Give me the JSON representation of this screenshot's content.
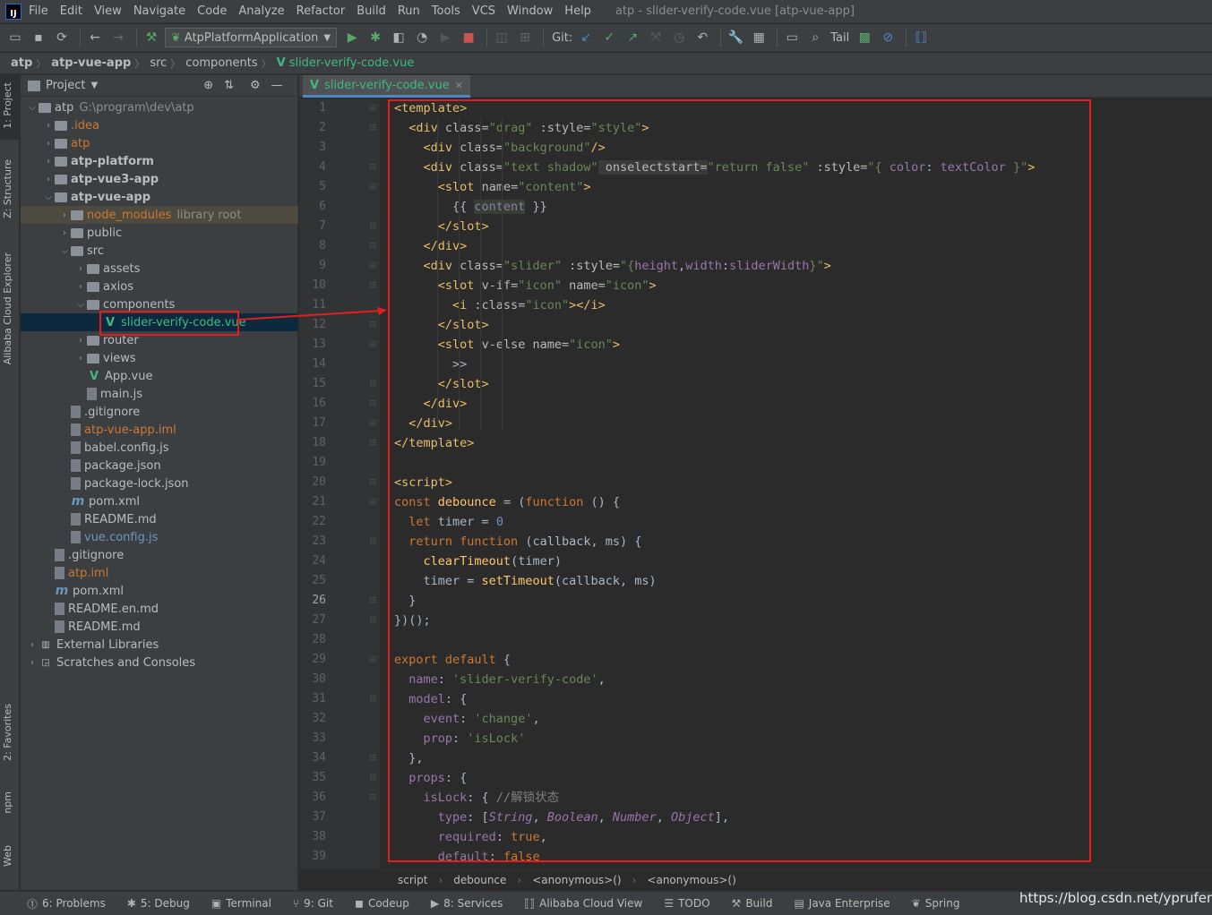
{
  "menu": {
    "logo": "IJ",
    "items": [
      "File",
      "Edit",
      "View",
      "Navigate",
      "Code",
      "Analyze",
      "Refactor",
      "Build",
      "Run",
      "Tools",
      "VCS",
      "Window",
      "Help"
    ],
    "window_title": "atp - slider-verify-code.vue [atp-vue-app]"
  },
  "toolbar": {
    "run_config": "AtpPlatformApplication",
    "git_label": "Git:",
    "tail_label": "Tail"
  },
  "breadcrumb": [
    "atp",
    "atp-vue-app",
    "src",
    "components",
    "slider-verify-code.vue"
  ],
  "left_tabs": {
    "project": "1: Project",
    "structure": "Z: Structure",
    "alibaba": "Alibaba Cloud Explorer",
    "favorites": "2: Favorites",
    "npm": "npm",
    "web": "Web"
  },
  "project_panel": {
    "title": "Project",
    "tree": [
      {
        "label": "atp",
        "hint": "G:\\program\\dev\\atp",
        "depth": 0,
        "type": "folder",
        "open": true
      },
      {
        "label": ".idea",
        "depth": 1,
        "type": "folder",
        "style": "orange"
      },
      {
        "label": "atp",
        "depth": 1,
        "type": "folder",
        "style": "orange"
      },
      {
        "label": "atp-platform",
        "depth": 1,
        "type": "folder",
        "bold": true
      },
      {
        "label": "atp-vue3-app",
        "depth": 1,
        "type": "folder",
        "bold": true
      },
      {
        "label": "atp-vue-app",
        "depth": 1,
        "type": "folder",
        "bold": true,
        "open": true
      },
      {
        "label": "node_modules",
        "hint": "library root",
        "depth": 2,
        "type": "folder",
        "style": "orange",
        "highlight": true
      },
      {
        "label": "public",
        "depth": 2,
        "type": "folder"
      },
      {
        "label": "src",
        "depth": 2,
        "type": "folder",
        "open": true
      },
      {
        "label": "assets",
        "depth": 3,
        "type": "folder"
      },
      {
        "label": "axios",
        "depth": 3,
        "type": "folder"
      },
      {
        "label": "components",
        "depth": 3,
        "type": "folder",
        "open": true
      },
      {
        "label": "slider-verify-code.vue",
        "depth": 4,
        "type": "vue",
        "selected": true
      },
      {
        "label": "router",
        "depth": 3,
        "type": "folder"
      },
      {
        "label": "views",
        "depth": 3,
        "type": "folder"
      },
      {
        "label": "App.vue",
        "depth": 3,
        "type": "vue",
        "leaf": true
      },
      {
        "label": "main.js",
        "depth": 3,
        "type": "file",
        "leaf": true
      },
      {
        "label": ".gitignore",
        "depth": 2,
        "type": "file",
        "leaf": true
      },
      {
        "label": "atp-vue-app.iml",
        "depth": 2,
        "type": "file",
        "style": "orange",
        "leaf": true
      },
      {
        "label": "babel.config.js",
        "depth": 2,
        "type": "file",
        "leaf": true
      },
      {
        "label": "package.json",
        "depth": 2,
        "type": "file",
        "leaf": true
      },
      {
        "label": "package-lock.json",
        "depth": 2,
        "type": "file",
        "leaf": true
      },
      {
        "label": "pom.xml",
        "depth": 2,
        "type": "m",
        "leaf": true
      },
      {
        "label": "README.md",
        "depth": 2,
        "type": "file",
        "leaf": true
      },
      {
        "label": "vue.config.js",
        "depth": 2,
        "type": "file",
        "style": "blue",
        "leaf": true
      },
      {
        "label": ".gitignore",
        "depth": 1,
        "type": "file",
        "leaf": true
      },
      {
        "label": "atp.iml",
        "depth": 1,
        "type": "file",
        "style": "orange",
        "leaf": true
      },
      {
        "label": "pom.xml",
        "depth": 1,
        "type": "m",
        "leaf": true
      },
      {
        "label": "README.en.md",
        "depth": 1,
        "type": "file",
        "leaf": true
      },
      {
        "label": "README.md",
        "depth": 1,
        "type": "file",
        "leaf": true
      },
      {
        "label": "External Libraries",
        "depth": 0,
        "type": "lib"
      },
      {
        "label": "Scratches and Consoles",
        "depth": 0,
        "type": "scratch"
      }
    ]
  },
  "editor": {
    "tab": "slider-verify-code.vue",
    "current_line": 26,
    "lines": [
      [
        [
          "tag",
          "<template>"
        ]
      ],
      [
        [
          "plain",
          "  "
        ],
        [
          "tag",
          "<div "
        ],
        [
          "attr",
          "class="
        ],
        [
          "str",
          "\"drag\""
        ],
        [
          "attr",
          " :style="
        ],
        [
          "str",
          "\"style\""
        ],
        [
          "tag",
          ">"
        ]
      ],
      [
        [
          "plain",
          "    "
        ],
        [
          "tag",
          "<div "
        ],
        [
          "attr",
          "class="
        ],
        [
          "str",
          "\"background\""
        ],
        [
          "tag",
          "/>"
        ]
      ],
      [
        [
          "plain",
          "    "
        ],
        [
          "tag",
          "<div "
        ],
        [
          "attr",
          "class="
        ],
        [
          "str",
          "\"text shadow\""
        ],
        [
          "attr",
          " onselectstart="
        ],
        [
          "str",
          "\"return false\""
        ],
        [
          "attr",
          " :style="
        ],
        [
          "str",
          "\"{ "
        ],
        [
          "prop",
          "color"
        ],
        [
          "plain",
          ": "
        ],
        [
          "prop",
          "textColor"
        ],
        [
          "str",
          " }\""
        ],
        [
          "tag",
          ">"
        ]
      ],
      [
        [
          "plain",
          "      "
        ],
        [
          "tag",
          "<slot "
        ],
        [
          "attr",
          "name="
        ],
        [
          "str",
          "\"content\""
        ],
        [
          "tag",
          ">"
        ]
      ],
      [
        [
          "plain",
          "        {{ "
        ],
        [
          "prop",
          "content"
        ],
        [
          "plain",
          " }}"
        ]
      ],
      [
        [
          "plain",
          "      "
        ],
        [
          "tag",
          "</slot>"
        ]
      ],
      [
        [
          "plain",
          "    "
        ],
        [
          "tag",
          "</div>"
        ]
      ],
      [
        [
          "plain",
          "    "
        ],
        [
          "tag",
          "<div "
        ],
        [
          "attr",
          "class="
        ],
        [
          "str",
          "\"slider\""
        ],
        [
          "attr",
          " :style="
        ],
        [
          "str",
          "\"{"
        ],
        [
          "prop",
          "height"
        ],
        [
          "plain",
          ","
        ],
        [
          "prop",
          "width"
        ],
        [
          "plain",
          ":"
        ],
        [
          "prop",
          "sliderWidth"
        ],
        [
          "str",
          "}\""
        ],
        [
          "tag",
          ">"
        ]
      ],
      [
        [
          "plain",
          "      "
        ],
        [
          "tag",
          "<slot "
        ],
        [
          "attr",
          "v-if="
        ],
        [
          "str",
          "\"icon\""
        ],
        [
          "attr",
          " name="
        ],
        [
          "str",
          "\"icon\""
        ],
        [
          "tag",
          ">"
        ]
      ],
      [
        [
          "plain",
          "        "
        ],
        [
          "tag",
          "<i "
        ],
        [
          "attr",
          ":class="
        ],
        [
          "str",
          "\"icon\""
        ],
        [
          "tag",
          "></i>"
        ]
      ],
      [
        [
          "plain",
          "      "
        ],
        [
          "tag",
          "</slot>"
        ]
      ],
      [
        [
          "plain",
          "      "
        ],
        [
          "tag",
          "<slot "
        ],
        [
          "attr",
          "v-else name="
        ],
        [
          "str",
          "\"icon\""
        ],
        [
          "tag",
          ">"
        ]
      ],
      [
        [
          "plain",
          "        >>"
        ]
      ],
      [
        [
          "plain",
          "      "
        ],
        [
          "tag",
          "</slot>"
        ]
      ],
      [
        [
          "plain",
          "    "
        ],
        [
          "tag",
          "</div>"
        ]
      ],
      [
        [
          "plain",
          "  "
        ],
        [
          "tag",
          "</div>"
        ]
      ],
      [
        [
          "tag",
          "</template>"
        ]
      ],
      [
        [
          "plain",
          ""
        ]
      ],
      [
        [
          "tag",
          "<script>"
        ]
      ],
      [
        [
          "kw",
          "const "
        ],
        [
          "fn",
          "debounce"
        ],
        [
          "plain",
          " = ("
        ],
        [
          "kw",
          "function"
        ],
        [
          "plain",
          " () {"
        ]
      ],
      [
        [
          "plain",
          "  "
        ],
        [
          "kw",
          "let "
        ],
        [
          "plain",
          "timer = "
        ],
        [
          "num",
          "0"
        ]
      ],
      [
        [
          "plain",
          "  "
        ],
        [
          "kw",
          "return function "
        ],
        [
          "plain",
          "(callback, ms) {"
        ]
      ],
      [
        [
          "plain",
          "    "
        ],
        [
          "fn",
          "clearTimeout"
        ],
        [
          "plain",
          "(timer)"
        ]
      ],
      [
        [
          "plain",
          "    timer = "
        ],
        [
          "fn",
          "setTimeout"
        ],
        [
          "plain",
          "(callback, ms)"
        ]
      ],
      [
        [
          "plain",
          "  }"
        ]
      ],
      [
        [
          "plain",
          "})();"
        ]
      ],
      [
        [
          "plain",
          ""
        ]
      ],
      [
        [
          "kw",
          "export default "
        ],
        [
          "plain",
          "{"
        ]
      ],
      [
        [
          "plain",
          "  "
        ],
        [
          "prop",
          "name"
        ],
        [
          "plain",
          ": "
        ],
        [
          "str",
          "'slider-verify-code'"
        ],
        [
          "plain",
          ","
        ]
      ],
      [
        [
          "plain",
          "  "
        ],
        [
          "prop",
          "model"
        ],
        [
          "plain",
          ": {"
        ]
      ],
      [
        [
          "plain",
          "    "
        ],
        [
          "prop",
          "event"
        ],
        [
          "plain",
          ": "
        ],
        [
          "str",
          "'change'"
        ],
        [
          "plain",
          ","
        ]
      ],
      [
        [
          "plain",
          "    "
        ],
        [
          "prop",
          "prop"
        ],
        [
          "plain",
          ": "
        ],
        [
          "str",
          "'isLock'"
        ]
      ],
      [
        [
          "plain",
          "  },"
        ]
      ],
      [
        [
          "plain",
          "  "
        ],
        [
          "prop",
          "props"
        ],
        [
          "plain",
          ": {"
        ]
      ],
      [
        [
          "plain",
          "    "
        ],
        [
          "prop",
          "isLock"
        ],
        [
          "plain",
          ": { "
        ],
        [
          "cmt",
          "//解锁状态"
        ]
      ],
      [
        [
          "plain",
          "      "
        ],
        [
          "prop",
          "type"
        ],
        [
          "plain",
          ": ["
        ],
        [
          "typ",
          "String"
        ],
        [
          "plain",
          ", "
        ],
        [
          "typ",
          "Boolean"
        ],
        [
          "plain",
          ", "
        ],
        [
          "typ",
          "Number"
        ],
        [
          "plain",
          ", "
        ],
        [
          "typ",
          "Object"
        ],
        [
          "plain",
          "],"
        ]
      ],
      [
        [
          "plain",
          "      "
        ],
        [
          "prop",
          "required"
        ],
        [
          "plain",
          ": "
        ],
        [
          "kw",
          "true"
        ],
        [
          "plain",
          ","
        ]
      ],
      [
        [
          "plain",
          "      "
        ],
        [
          "prop",
          "default"
        ],
        [
          "plain",
          ": "
        ],
        [
          "kw",
          "false"
        ]
      ]
    ]
  },
  "code_breadcrumb": [
    "script",
    "debounce",
    "<anonymous>()",
    "<anonymous>()"
  ],
  "statusbar": [
    {
      "icon": "problems-icon",
      "glyph": "⓵",
      "label": "6: Problems"
    },
    {
      "icon": "debug-icon",
      "glyph": "✱",
      "label": "5: Debug"
    },
    {
      "icon": "terminal-icon",
      "glyph": "▣",
      "label": "Terminal"
    },
    {
      "icon": "git-icon",
      "glyph": "⑂",
      "label": "9: Git"
    },
    {
      "icon": "codeup-icon",
      "glyph": "◼",
      "label": "Codeup"
    },
    {
      "icon": "services-icon",
      "glyph": "▶",
      "label": "8: Services"
    },
    {
      "icon": "alibaba-cloud-icon",
      "glyph": "⟦⟧",
      "label": "Alibaba Cloud View"
    },
    {
      "icon": "todo-icon",
      "glyph": "☰",
      "label": "TODO"
    },
    {
      "icon": "build-icon",
      "glyph": "⚒",
      "label": "Build"
    },
    {
      "icon": "java-enterprise-icon",
      "glyph": "▤",
      "label": "Java Enterprise"
    },
    {
      "icon": "spring-icon",
      "glyph": "❦",
      "label": "Spring"
    }
  ],
  "watermark": "https://blog.csdn.net/yprufeng",
  "colors": {
    "accent": "#4a88c7",
    "annotation": "#e31e1e",
    "vue": "#41b883"
  }
}
